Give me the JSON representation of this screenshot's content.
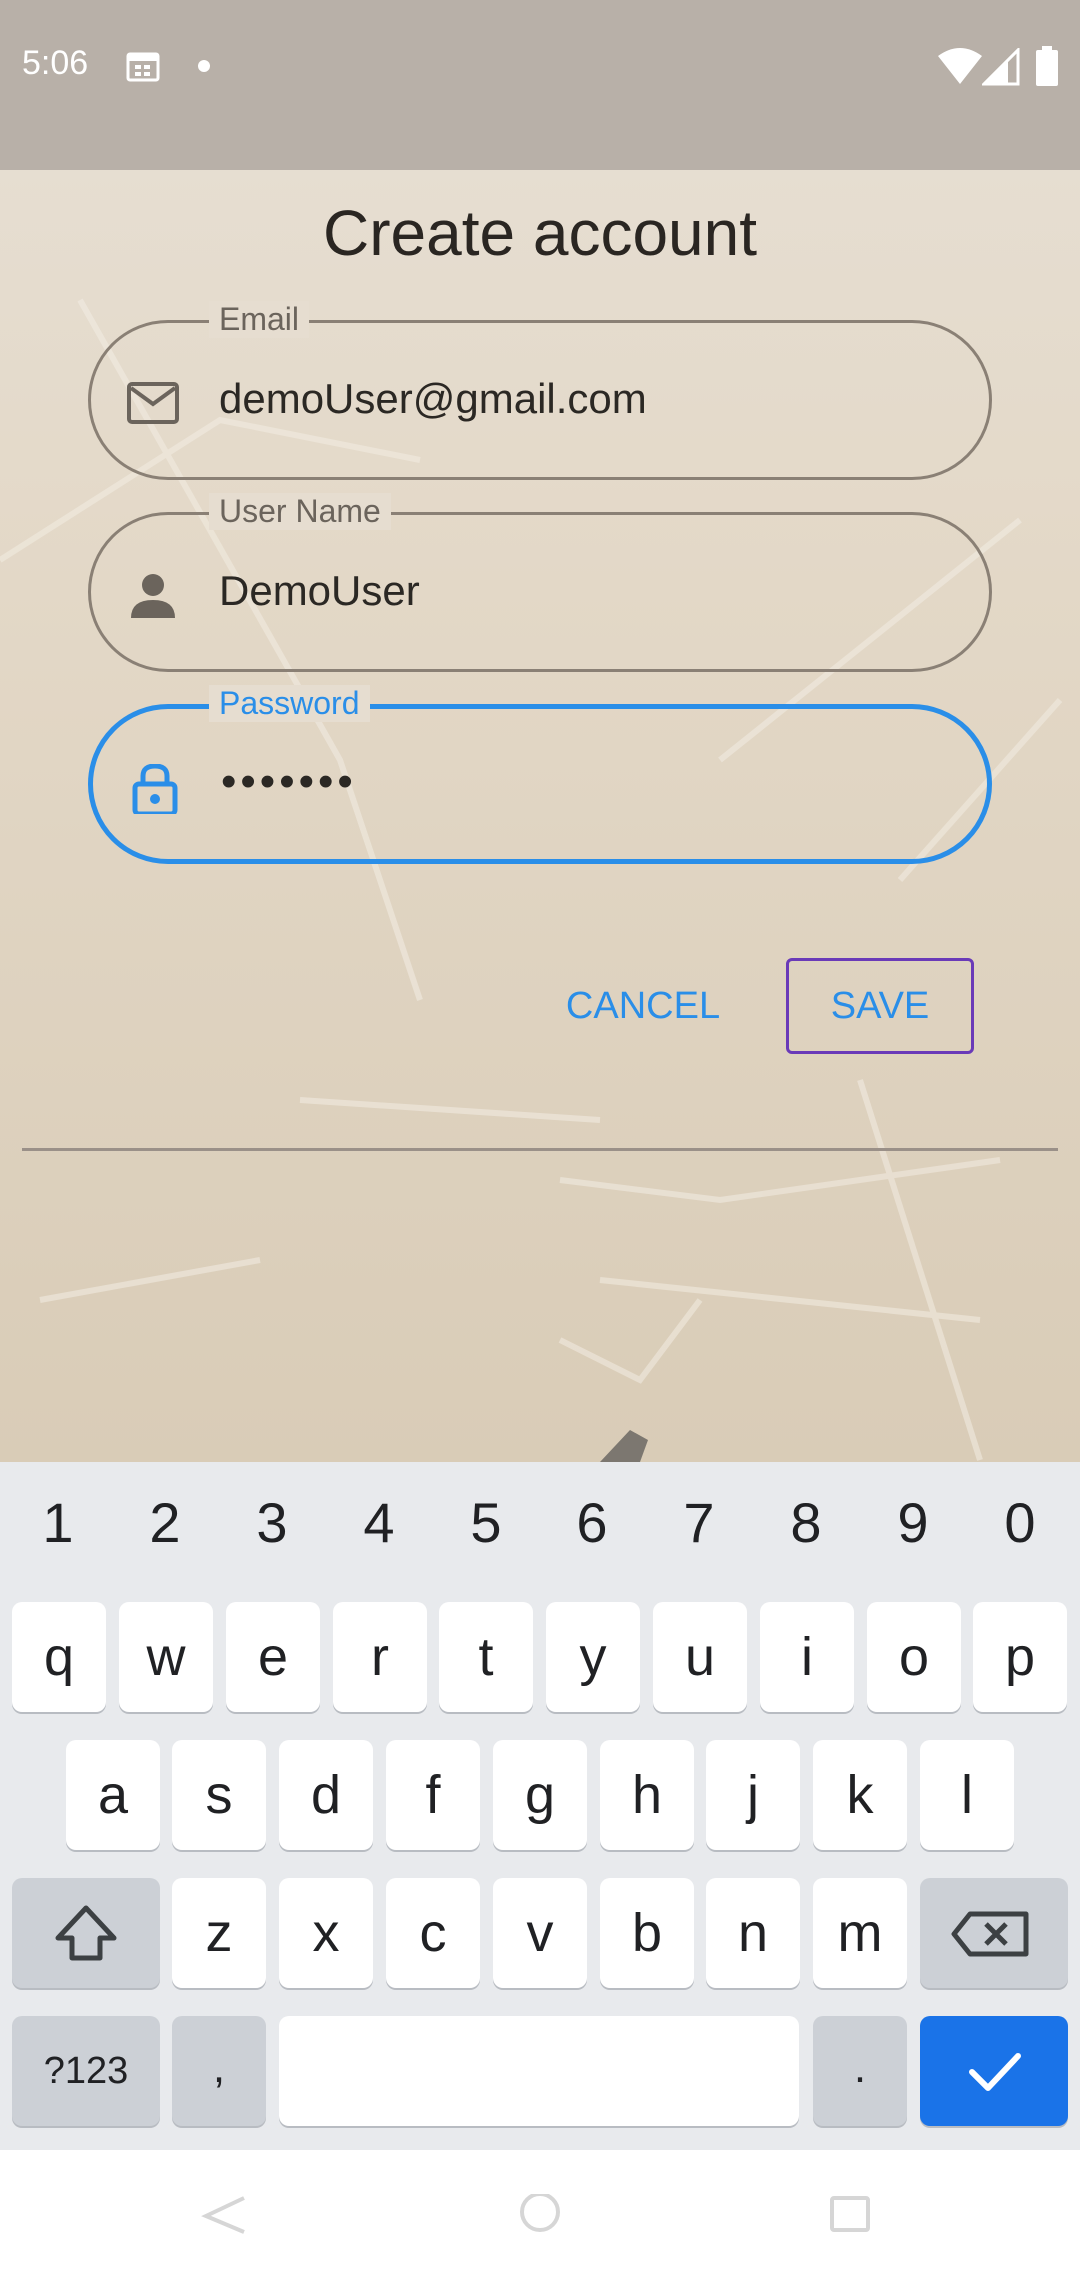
{
  "status_bar": {
    "time": "5:06",
    "icons": [
      "calendar-icon",
      "notification-dot",
      "wifi-icon",
      "signal-icon",
      "battery-icon"
    ]
  },
  "title": "Create account",
  "fields": {
    "email": {
      "label": "Email",
      "value": "demoUser@gmail.com",
      "icon": "mail-icon"
    },
    "username": {
      "label": "User Name",
      "value": "DemoUser",
      "icon": "person-icon"
    },
    "password": {
      "label": "Password",
      "value": "•••••••",
      "icon": "lock-icon"
    }
  },
  "buttons": {
    "cancel": "CANCEL",
    "save": "SAVE"
  },
  "colors": {
    "accent": "#2a8ee8",
    "save_border": "#6a3ab8",
    "keyboard_action": "#1a73e8"
  },
  "keyboard": {
    "numbers": [
      "1",
      "2",
      "3",
      "4",
      "5",
      "6",
      "7",
      "8",
      "9",
      "0"
    ],
    "row1": [
      "q",
      "w",
      "e",
      "r",
      "t",
      "y",
      "u",
      "i",
      "o",
      "p"
    ],
    "row2": [
      "a",
      "s",
      "d",
      "f",
      "g",
      "h",
      "j",
      "k",
      "l"
    ],
    "row3": [
      "z",
      "x",
      "c",
      "v",
      "b",
      "n",
      "m"
    ],
    "symbols_key": "?123",
    "comma_key": ",",
    "period_key": "."
  }
}
